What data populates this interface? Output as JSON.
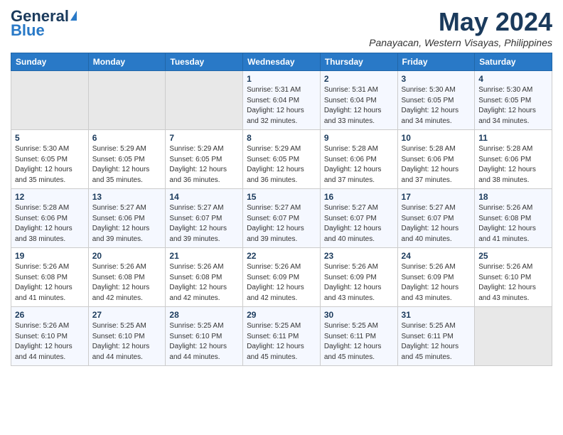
{
  "logo": {
    "line1": "General",
    "line2": "Blue"
  },
  "title": "May 2024",
  "location": "Panayacan, Western Visayas, Philippines",
  "header_days": [
    "Sunday",
    "Monday",
    "Tuesday",
    "Wednesday",
    "Thursday",
    "Friday",
    "Saturday"
  ],
  "weeks": [
    [
      {
        "day": "",
        "info": ""
      },
      {
        "day": "",
        "info": ""
      },
      {
        "day": "",
        "info": ""
      },
      {
        "day": "1",
        "info": "Sunrise: 5:31 AM\nSunset: 6:04 PM\nDaylight: 12 hours\nand 32 minutes."
      },
      {
        "day": "2",
        "info": "Sunrise: 5:31 AM\nSunset: 6:04 PM\nDaylight: 12 hours\nand 33 minutes."
      },
      {
        "day": "3",
        "info": "Sunrise: 5:30 AM\nSunset: 6:05 PM\nDaylight: 12 hours\nand 34 minutes."
      },
      {
        "day": "4",
        "info": "Sunrise: 5:30 AM\nSunset: 6:05 PM\nDaylight: 12 hours\nand 34 minutes."
      }
    ],
    [
      {
        "day": "5",
        "info": "Sunrise: 5:30 AM\nSunset: 6:05 PM\nDaylight: 12 hours\nand 35 minutes."
      },
      {
        "day": "6",
        "info": "Sunrise: 5:29 AM\nSunset: 6:05 PM\nDaylight: 12 hours\nand 35 minutes."
      },
      {
        "day": "7",
        "info": "Sunrise: 5:29 AM\nSunset: 6:05 PM\nDaylight: 12 hours\nand 36 minutes."
      },
      {
        "day": "8",
        "info": "Sunrise: 5:29 AM\nSunset: 6:05 PM\nDaylight: 12 hours\nand 36 minutes."
      },
      {
        "day": "9",
        "info": "Sunrise: 5:28 AM\nSunset: 6:06 PM\nDaylight: 12 hours\nand 37 minutes."
      },
      {
        "day": "10",
        "info": "Sunrise: 5:28 AM\nSunset: 6:06 PM\nDaylight: 12 hours\nand 37 minutes."
      },
      {
        "day": "11",
        "info": "Sunrise: 5:28 AM\nSunset: 6:06 PM\nDaylight: 12 hours\nand 38 minutes."
      }
    ],
    [
      {
        "day": "12",
        "info": "Sunrise: 5:28 AM\nSunset: 6:06 PM\nDaylight: 12 hours\nand 38 minutes."
      },
      {
        "day": "13",
        "info": "Sunrise: 5:27 AM\nSunset: 6:06 PM\nDaylight: 12 hours\nand 39 minutes."
      },
      {
        "day": "14",
        "info": "Sunrise: 5:27 AM\nSunset: 6:07 PM\nDaylight: 12 hours\nand 39 minutes."
      },
      {
        "day": "15",
        "info": "Sunrise: 5:27 AM\nSunset: 6:07 PM\nDaylight: 12 hours\nand 39 minutes."
      },
      {
        "day": "16",
        "info": "Sunrise: 5:27 AM\nSunset: 6:07 PM\nDaylight: 12 hours\nand 40 minutes."
      },
      {
        "day": "17",
        "info": "Sunrise: 5:27 AM\nSunset: 6:07 PM\nDaylight: 12 hours\nand 40 minutes."
      },
      {
        "day": "18",
        "info": "Sunrise: 5:26 AM\nSunset: 6:08 PM\nDaylight: 12 hours\nand 41 minutes."
      }
    ],
    [
      {
        "day": "19",
        "info": "Sunrise: 5:26 AM\nSunset: 6:08 PM\nDaylight: 12 hours\nand 41 minutes."
      },
      {
        "day": "20",
        "info": "Sunrise: 5:26 AM\nSunset: 6:08 PM\nDaylight: 12 hours\nand 42 minutes."
      },
      {
        "day": "21",
        "info": "Sunrise: 5:26 AM\nSunset: 6:08 PM\nDaylight: 12 hours\nand 42 minutes."
      },
      {
        "day": "22",
        "info": "Sunrise: 5:26 AM\nSunset: 6:09 PM\nDaylight: 12 hours\nand 42 minutes."
      },
      {
        "day": "23",
        "info": "Sunrise: 5:26 AM\nSunset: 6:09 PM\nDaylight: 12 hours\nand 43 minutes."
      },
      {
        "day": "24",
        "info": "Sunrise: 5:26 AM\nSunset: 6:09 PM\nDaylight: 12 hours\nand 43 minutes."
      },
      {
        "day": "25",
        "info": "Sunrise: 5:26 AM\nSunset: 6:10 PM\nDaylight: 12 hours\nand 43 minutes."
      }
    ],
    [
      {
        "day": "26",
        "info": "Sunrise: 5:26 AM\nSunset: 6:10 PM\nDaylight: 12 hours\nand 44 minutes."
      },
      {
        "day": "27",
        "info": "Sunrise: 5:25 AM\nSunset: 6:10 PM\nDaylight: 12 hours\nand 44 minutes."
      },
      {
        "day": "28",
        "info": "Sunrise: 5:25 AM\nSunset: 6:10 PM\nDaylight: 12 hours\nand 44 minutes."
      },
      {
        "day": "29",
        "info": "Sunrise: 5:25 AM\nSunset: 6:11 PM\nDaylight: 12 hours\nand 45 minutes."
      },
      {
        "day": "30",
        "info": "Sunrise: 5:25 AM\nSunset: 6:11 PM\nDaylight: 12 hours\nand 45 minutes."
      },
      {
        "day": "31",
        "info": "Sunrise: 5:25 AM\nSunset: 6:11 PM\nDaylight: 12 hours\nand 45 minutes."
      },
      {
        "day": "",
        "info": ""
      }
    ]
  ]
}
